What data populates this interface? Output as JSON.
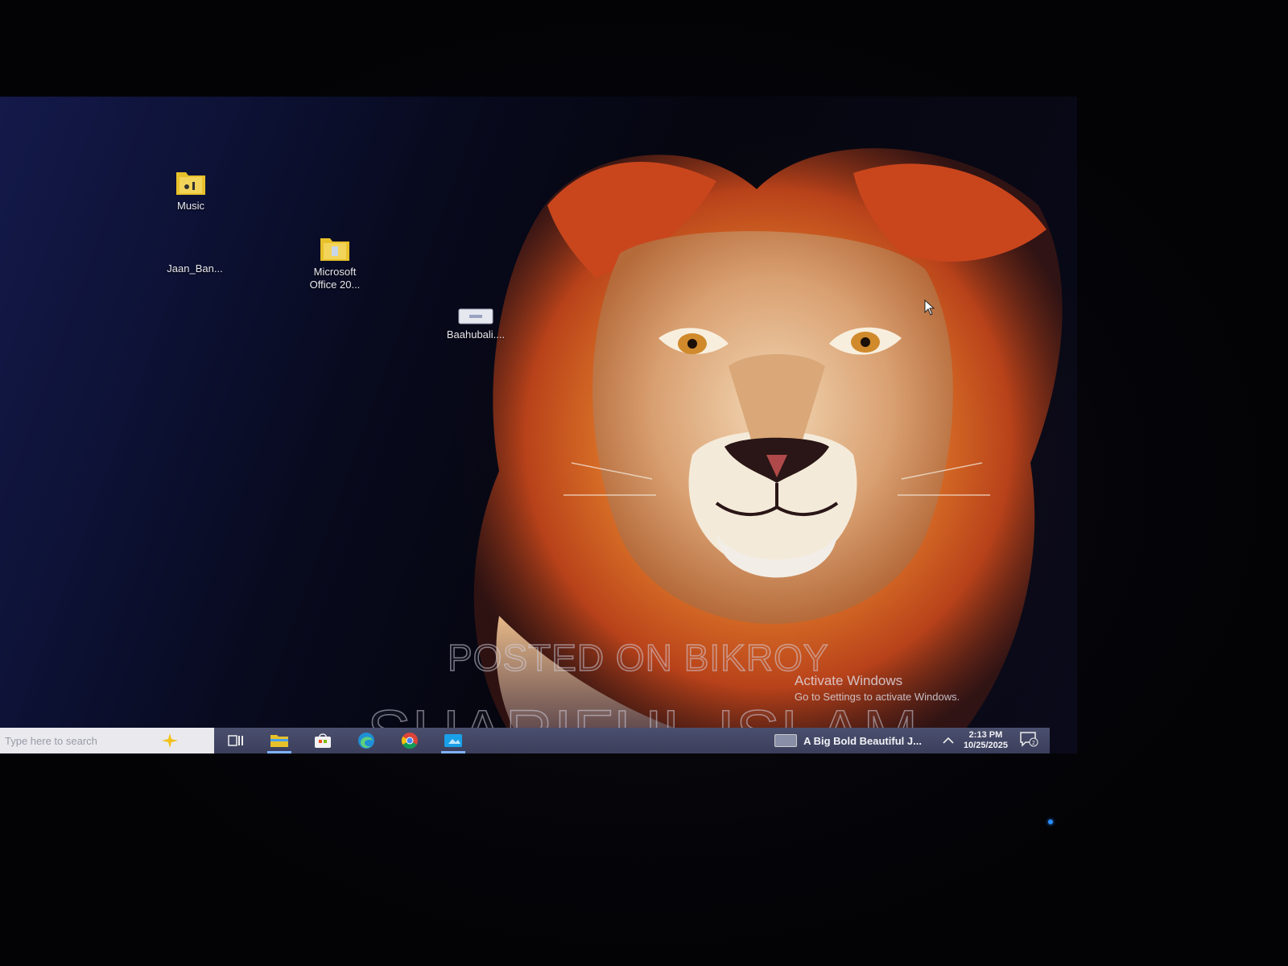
{
  "desktop": {
    "icons": [
      {
        "label": "Music",
        "icon": "music-folder-icon"
      },
      {
        "label": "Jaan_Ban...",
        "icon": "media-file-icon"
      },
      {
        "label_line1": "Microsoft",
        "label_line2": "Office 20...",
        "icon": "folder-icon"
      },
      {
        "label": "Baahubali....",
        "icon": "video-file-icon"
      }
    ]
  },
  "watermark": {
    "line1": "POSTED ON BIKROY",
    "line2": "SHARIFUL ISLAM"
  },
  "activation": {
    "title": "Activate Windows",
    "subtitle": "Go to Settings to activate Windows."
  },
  "taskbar": {
    "search_placeholder": "Type here to search",
    "pinned": [
      {
        "name": "task-view",
        "icon": "task-view-icon"
      },
      {
        "name": "file-explorer",
        "icon": "folder-icon",
        "active": true
      },
      {
        "name": "microsoft-store",
        "icon": "store-icon"
      },
      {
        "name": "edge",
        "icon": "edge-icon"
      },
      {
        "name": "chrome",
        "icon": "chrome-icon"
      },
      {
        "name": "photos",
        "icon": "photos-icon",
        "active": true
      }
    ],
    "news_text": "A Big Bold Beautiful J...",
    "time": "2:13 PM",
    "date": "10/25/2025",
    "notification_count": "2"
  },
  "colors": {
    "taskbar": "#3f4462",
    "accent": "#7fb2ff",
    "folder": "#e8c12a"
  }
}
